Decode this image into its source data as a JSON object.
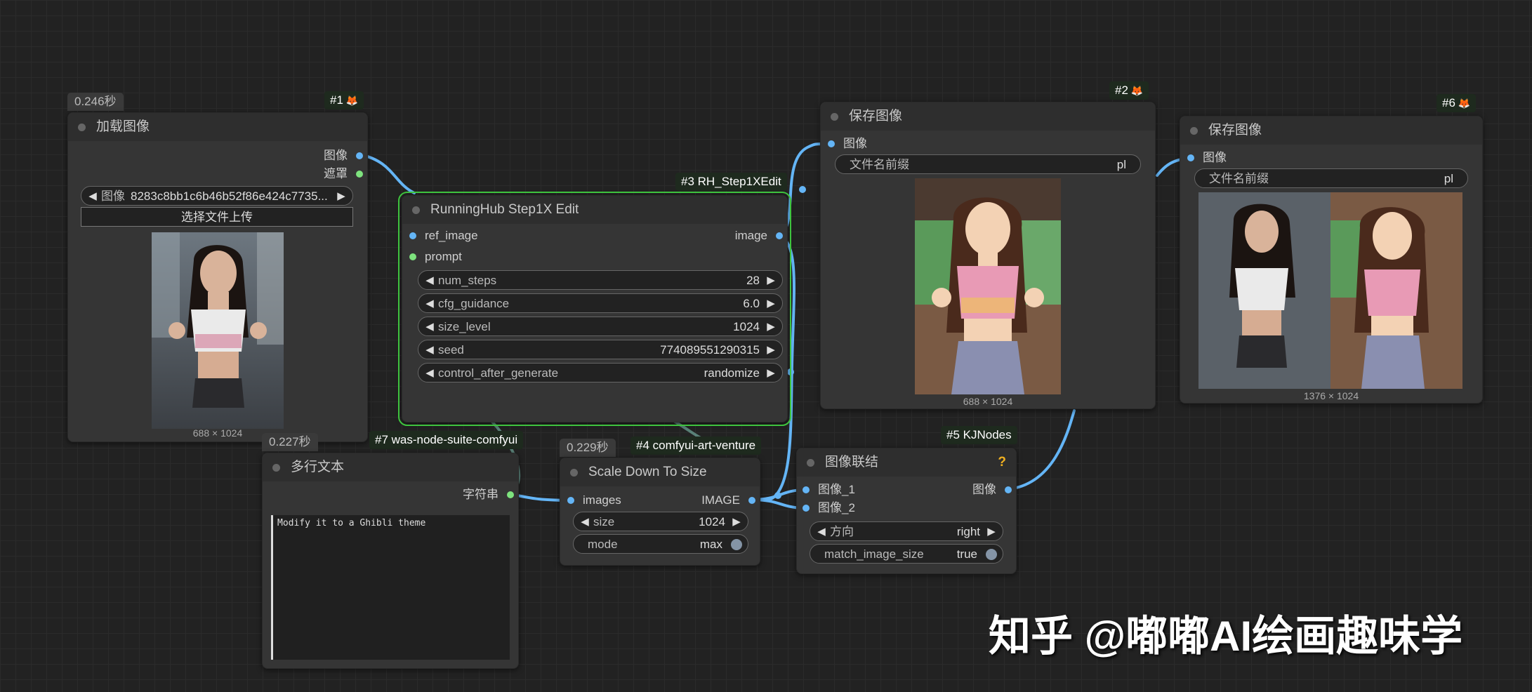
{
  "nodes": {
    "n1": {
      "timer": "0.246秒",
      "badge": "#1",
      "title": "加载图像",
      "out_image": "图像",
      "out_mask": "遮罩",
      "file_label": "图像",
      "file_value": "8283c8bb1c6b46b52f86e424c7735...",
      "upload_button": "选择文件上传",
      "dims": "688 × 1024"
    },
    "n2": {
      "badge": "#2",
      "title": "保存图像",
      "in_image": "图像",
      "prefix_label": "文件名前缀",
      "prefix_value": "pl",
      "dims": "688 × 1024"
    },
    "n3": {
      "badge": "#3 RH_Step1XEdit",
      "title": "RunningHub Step1X Edit",
      "in_ref_image": "ref_image",
      "in_prompt": "prompt",
      "out_image": "image",
      "widgets": [
        {
          "label": "num_steps",
          "value": "28"
        },
        {
          "label": "cfg_guidance",
          "value": "6.0"
        },
        {
          "label": "size_level",
          "value": "1024"
        },
        {
          "label": "seed",
          "value": "774089551290315"
        },
        {
          "label": "control_after_generate",
          "value": "randomize"
        }
      ]
    },
    "n4": {
      "timer": "0.229秒",
      "badge": "#4 comfyui-art-venture",
      "title": "Scale Down To Size",
      "in_images": "images",
      "out_image": "IMAGE",
      "size_label": "size",
      "size_value": "1024",
      "mode_label": "mode",
      "mode_value": "max"
    },
    "n5": {
      "badge": "#5 KJNodes",
      "title": "图像联结",
      "question": "?",
      "in_image1": "图像_1",
      "in_image2": "图像_2",
      "out_image": "图像",
      "dir_label": "方向",
      "dir_value": "right",
      "match_label": "match_image_size",
      "match_value": "true"
    },
    "n6": {
      "badge": "#6",
      "title": "保存图像",
      "in_image": "图像",
      "prefix_label": "文件名前缀",
      "prefix_value": "pl",
      "dims": "1376 × 1024"
    },
    "n7": {
      "timer": "0.227秒",
      "badge": "#7 was-node-suite-comfyui",
      "title": "多行文本",
      "out_string": "字符串",
      "text": "Modify it to a Ghibli theme"
    }
  },
  "watermark": "知乎 @嘟嘟AI绘画趣味学",
  "colors": {
    "link": "#64b5f6",
    "selected": "#3ec33e",
    "node_bg": "#353535",
    "canvas": "#222222"
  }
}
